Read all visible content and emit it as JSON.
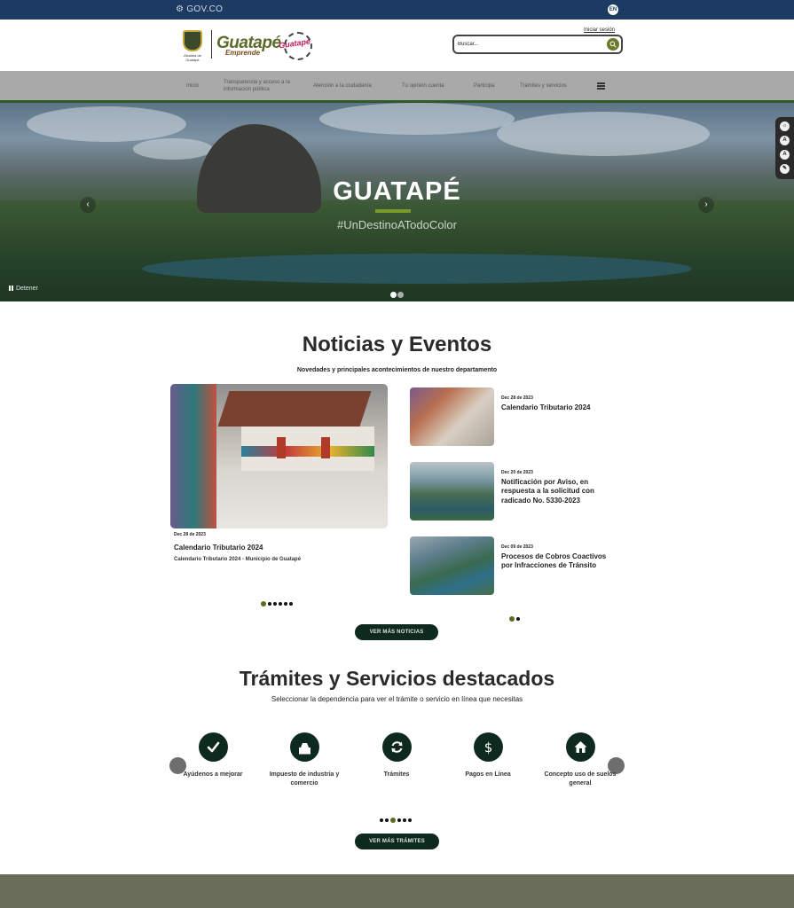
{
  "govbar": {
    "label": "GOV.CO",
    "lang": "EN"
  },
  "header": {
    "crest_caption": "Alcaldía de Guatapé",
    "brand_main": "Guatapé",
    "brand_sub": "Emprende",
    "brand_badge": "Guatapé",
    "login": "Iniciar sesión",
    "search_placeholder": "Buscar..."
  },
  "nav": {
    "items": [
      "Inicio",
      "Transparencia y acceso a la información pública",
      "Atención a la ciudadanía",
      "Tu opinión cuenta",
      "Participa",
      "Trámites y servicios"
    ]
  },
  "hero": {
    "title": "GUATAPÉ",
    "tagline": "#UnDestinoATodoColor",
    "stop_label": "Detener",
    "slides": 2,
    "active_slide": 1
  },
  "accessibility": {
    "buttons": [
      "☼",
      "A",
      "A",
      "✎"
    ]
  },
  "news": {
    "title": "Noticias y Eventos",
    "subtitle": "Novedades y principales acontecimientos de nuestro departamento",
    "featured": {
      "date": "Dec 28 de 2023",
      "title": "Calendario Tributario 2024",
      "desc": "Calendario Tributario 2024 - Municipio de Guatapé"
    },
    "items": [
      {
        "date": "Dec 28 de 2023",
        "title": "Calendario Tributario 2024"
      },
      {
        "date": "Dec 20 de 2023",
        "title": "Notificación por Aviso, en respuesta a la solicitud con radicado No. 5330-2023"
      },
      {
        "date": "Dec 09 de 2023",
        "title": "Procesos de Cobros Coactivos por Infracciones de Tránsito"
      }
    ],
    "more_button": "VER MÁS NOTICIAS"
  },
  "services": {
    "title": "Trámites y Servicios destacados",
    "subtitle": "Seleccionar la dependencia para ver el trámite o servicio en línea que necesitas",
    "items": [
      {
        "label": "Ayúdenos a mejorar",
        "icon": "check-icon"
      },
      {
        "label": "Impuesto de industria y comercio",
        "icon": "building-icon"
      },
      {
        "label": "Trámites",
        "icon": "refresh-icon"
      },
      {
        "label": "Pagos en Línea",
        "icon": "dollar-icon"
      },
      {
        "label": "Concepto uso de suelos general",
        "icon": "home-icon"
      }
    ],
    "more_button": "VER MÁS TRÁMITES"
  },
  "colors": {
    "govbar": "#1d3a63",
    "accent_green": "#0e2a1e",
    "olive": "#5a6e22",
    "footer": "#6b6d5b"
  }
}
